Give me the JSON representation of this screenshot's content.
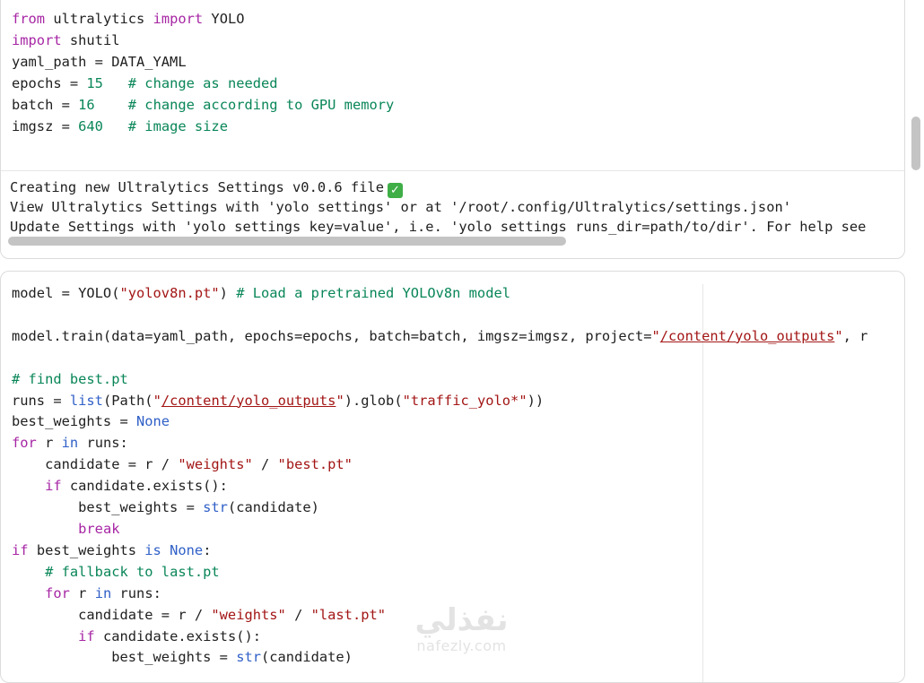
{
  "cell1": {
    "code": [
      {
        "tokens": [
          {
            "t": "from",
            "c": "kw"
          },
          {
            "t": " ultralytics ",
            "c": ""
          },
          {
            "t": "import",
            "c": "kw"
          },
          {
            "t": " YOLO",
            "c": ""
          }
        ]
      },
      {
        "tokens": [
          {
            "t": "import",
            "c": "kw"
          },
          {
            "t": " shutil",
            "c": ""
          }
        ]
      },
      {
        "tokens": [
          {
            "t": "yaml_path = DATA_YAML",
            "c": ""
          }
        ]
      },
      {
        "tokens": [
          {
            "t": "epochs = ",
            "c": ""
          },
          {
            "t": "15",
            "c": "num"
          },
          {
            "t": "   ",
            "c": ""
          },
          {
            "t": "# change as needed",
            "c": "cm"
          }
        ]
      },
      {
        "tokens": [
          {
            "t": "batch = ",
            "c": ""
          },
          {
            "t": "16",
            "c": "num"
          },
          {
            "t": "    ",
            "c": ""
          },
          {
            "t": "# change according to GPU memory",
            "c": "cm"
          }
        ]
      },
      {
        "tokens": [
          {
            "t": "imgsz = ",
            "c": ""
          },
          {
            "t": "640",
            "c": "num"
          },
          {
            "t": "   ",
            "c": ""
          },
          {
            "t": "# image size",
            "c": "cm"
          }
        ]
      }
    ],
    "output": {
      "line1": "Creating new Ultralytics Settings v0.0.6 file",
      "line1_icon": "✓",
      "line2": "View Ultralytics Settings with 'yolo settings' or at '/root/.config/Ultralytics/settings.json'",
      "line3": "Update Settings with 'yolo settings key=value', i.e. 'yolo settings runs_dir=path/to/dir'. For help see"
    }
  },
  "cell2": {
    "code": [
      {
        "tokens": [
          {
            "t": "model = YOLO(",
            "c": ""
          },
          {
            "t": "\"yolov8n.pt\"",
            "c": "str"
          },
          {
            "t": ") ",
            "c": ""
          },
          {
            "t": "# Load a pretrained YOLOv8n model",
            "c": "cm"
          }
        ]
      },
      {
        "tokens": [
          {
            "t": "",
            "c": ""
          }
        ]
      },
      {
        "tokens": [
          {
            "t": "model.train(data=yaml_path, epochs=epochs, batch=batch, imgsz=imgsz, project=",
            "c": ""
          },
          {
            "t": "\"",
            "c": "str"
          },
          {
            "t": "/content/yolo_outputs",
            "c": "str link"
          },
          {
            "t": "\"",
            "c": "str"
          },
          {
            "t": ", r",
            "c": ""
          }
        ]
      },
      {
        "tokens": [
          {
            "t": "",
            "c": ""
          }
        ]
      },
      {
        "tokens": [
          {
            "t": "# find best.pt",
            "c": "cm"
          }
        ]
      },
      {
        "tokens": [
          {
            "t": "runs = ",
            "c": ""
          },
          {
            "t": "list",
            "c": "blt"
          },
          {
            "t": "(Path(",
            "c": ""
          },
          {
            "t": "\"",
            "c": "str"
          },
          {
            "t": "/content/yolo_outputs",
            "c": "str link"
          },
          {
            "t": "\"",
            "c": "str"
          },
          {
            "t": ").glob(",
            "c": ""
          },
          {
            "t": "\"traffic_yolo*\"",
            "c": "str"
          },
          {
            "t": "))",
            "c": ""
          }
        ]
      },
      {
        "tokens": [
          {
            "t": "best_weights = ",
            "c": ""
          },
          {
            "t": "None",
            "c": "blt"
          }
        ]
      },
      {
        "tokens": [
          {
            "t": "for",
            "c": "kw"
          },
          {
            "t": " r ",
            "c": ""
          },
          {
            "t": "in",
            "c": "blt"
          },
          {
            "t": " runs:",
            "c": ""
          }
        ]
      },
      {
        "tokens": [
          {
            "t": "    candidate = r / ",
            "c": ""
          },
          {
            "t": "\"weights\"",
            "c": "str"
          },
          {
            "t": " / ",
            "c": ""
          },
          {
            "t": "\"best.pt\"",
            "c": "str"
          }
        ]
      },
      {
        "tokens": [
          {
            "t": "    ",
            "c": ""
          },
          {
            "t": "if",
            "c": "kw"
          },
          {
            "t": " candidate.exists():",
            "c": ""
          }
        ]
      },
      {
        "tokens": [
          {
            "t": "        best_weights = ",
            "c": ""
          },
          {
            "t": "str",
            "c": "blt"
          },
          {
            "t": "(candidate)",
            "c": ""
          }
        ]
      },
      {
        "tokens": [
          {
            "t": "        ",
            "c": ""
          },
          {
            "t": "break",
            "c": "kw"
          }
        ]
      },
      {
        "tokens": [
          {
            "t": "if",
            "c": "kw"
          },
          {
            "t": " best_weights ",
            "c": ""
          },
          {
            "t": "is",
            "c": "blt"
          },
          {
            "t": " ",
            "c": ""
          },
          {
            "t": "None",
            "c": "blt"
          },
          {
            "t": ":",
            "c": ""
          }
        ]
      },
      {
        "tokens": [
          {
            "t": "    ",
            "c": ""
          },
          {
            "t": "# fallback to last.pt",
            "c": "cm"
          }
        ]
      },
      {
        "tokens": [
          {
            "t": "    ",
            "c": ""
          },
          {
            "t": "for",
            "c": "kw"
          },
          {
            "t": " r ",
            "c": ""
          },
          {
            "t": "in",
            "c": "blt"
          },
          {
            "t": " runs:",
            "c": ""
          }
        ]
      },
      {
        "tokens": [
          {
            "t": "        candidate = r / ",
            "c": ""
          },
          {
            "t": "\"weights\"",
            "c": "str"
          },
          {
            "t": " / ",
            "c": ""
          },
          {
            "t": "\"last.pt\"",
            "c": "str"
          }
        ]
      },
      {
        "tokens": [
          {
            "t": "        ",
            "c": ""
          },
          {
            "t": "if",
            "c": "kw"
          },
          {
            "t": " candidate.exists():",
            "c": ""
          }
        ]
      },
      {
        "tokens": [
          {
            "t": "            best_weights = ",
            "c": ""
          },
          {
            "t": "str",
            "c": "blt"
          },
          {
            "t": "(candidate)",
            "c": ""
          }
        ]
      }
    ]
  },
  "watermark": {
    "arabic": "نفذلي",
    "latin": "nafezly.com"
  }
}
